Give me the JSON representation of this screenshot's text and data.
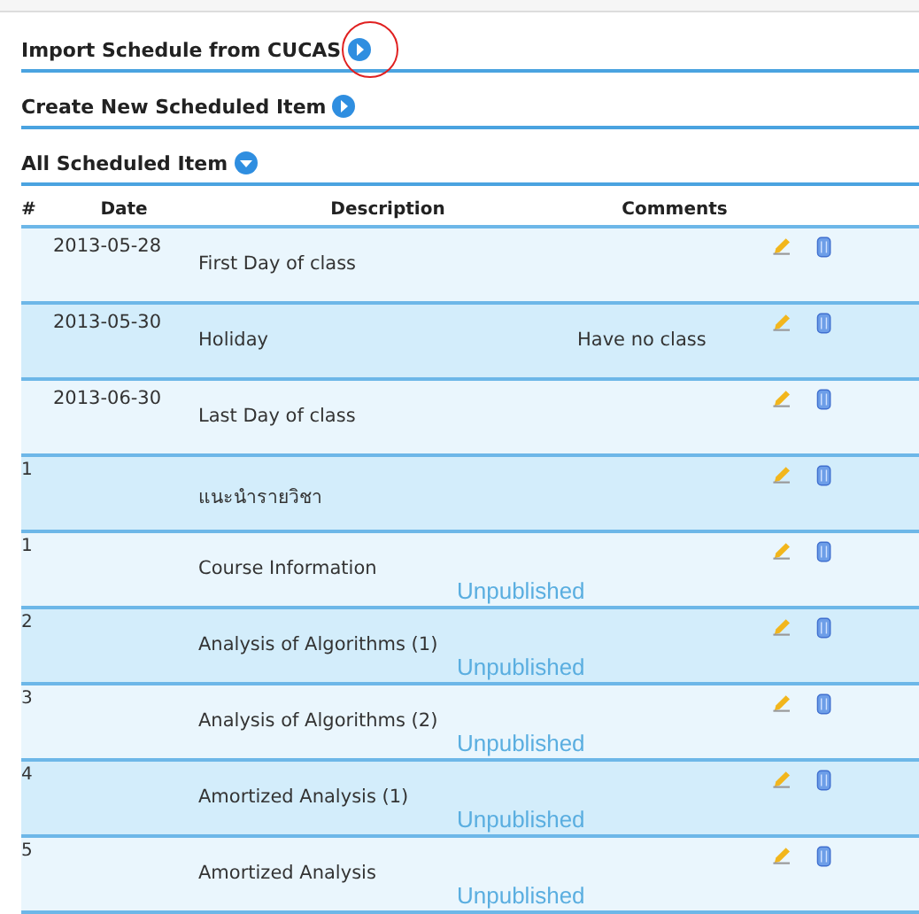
{
  "sections": [
    {
      "title": "Import Schedule from CUCAS",
      "circled": true,
      "expanded": false
    },
    {
      "title": "Create New Scheduled Item",
      "circled": false,
      "expanded": false
    },
    {
      "title": "All Scheduled Item",
      "circled": false,
      "expanded": true
    }
  ],
  "table": {
    "columns": [
      "#",
      "Date",
      "Description",
      "Comments"
    ],
    "rows": [
      {
        "number": "",
        "date": "2013-05-28",
        "description": "First Day of class",
        "comment": "",
        "status": ""
      },
      {
        "number": "",
        "date": "2013-05-30",
        "description": "Holiday",
        "comment": "Have no class",
        "status": ""
      },
      {
        "number": "",
        "date": "2013-06-30",
        "description": "Last Day of class",
        "comment": "",
        "status": ""
      },
      {
        "number": "1",
        "date": "",
        "description": "แนะนำรายวิชา",
        "comment": "",
        "status": ""
      },
      {
        "number": "1",
        "date": "",
        "description": "Course Information",
        "comment": "",
        "status": "Unpublished"
      },
      {
        "number": "2",
        "date": "",
        "description": "Analysis of Algorithms (1)",
        "comment": "",
        "status": "Unpublished"
      },
      {
        "number": "3",
        "date": "",
        "description": "Analysis of Algorithms (2)",
        "comment": "",
        "status": "Unpublished"
      },
      {
        "number": "4",
        "date": "",
        "description": "Amortized Analysis (1)",
        "comment": "",
        "status": "Unpublished"
      },
      {
        "number": "5",
        "date": "",
        "description": "Amortized Analysis",
        "comment": "",
        "status": "Unpublished"
      }
    ]
  }
}
